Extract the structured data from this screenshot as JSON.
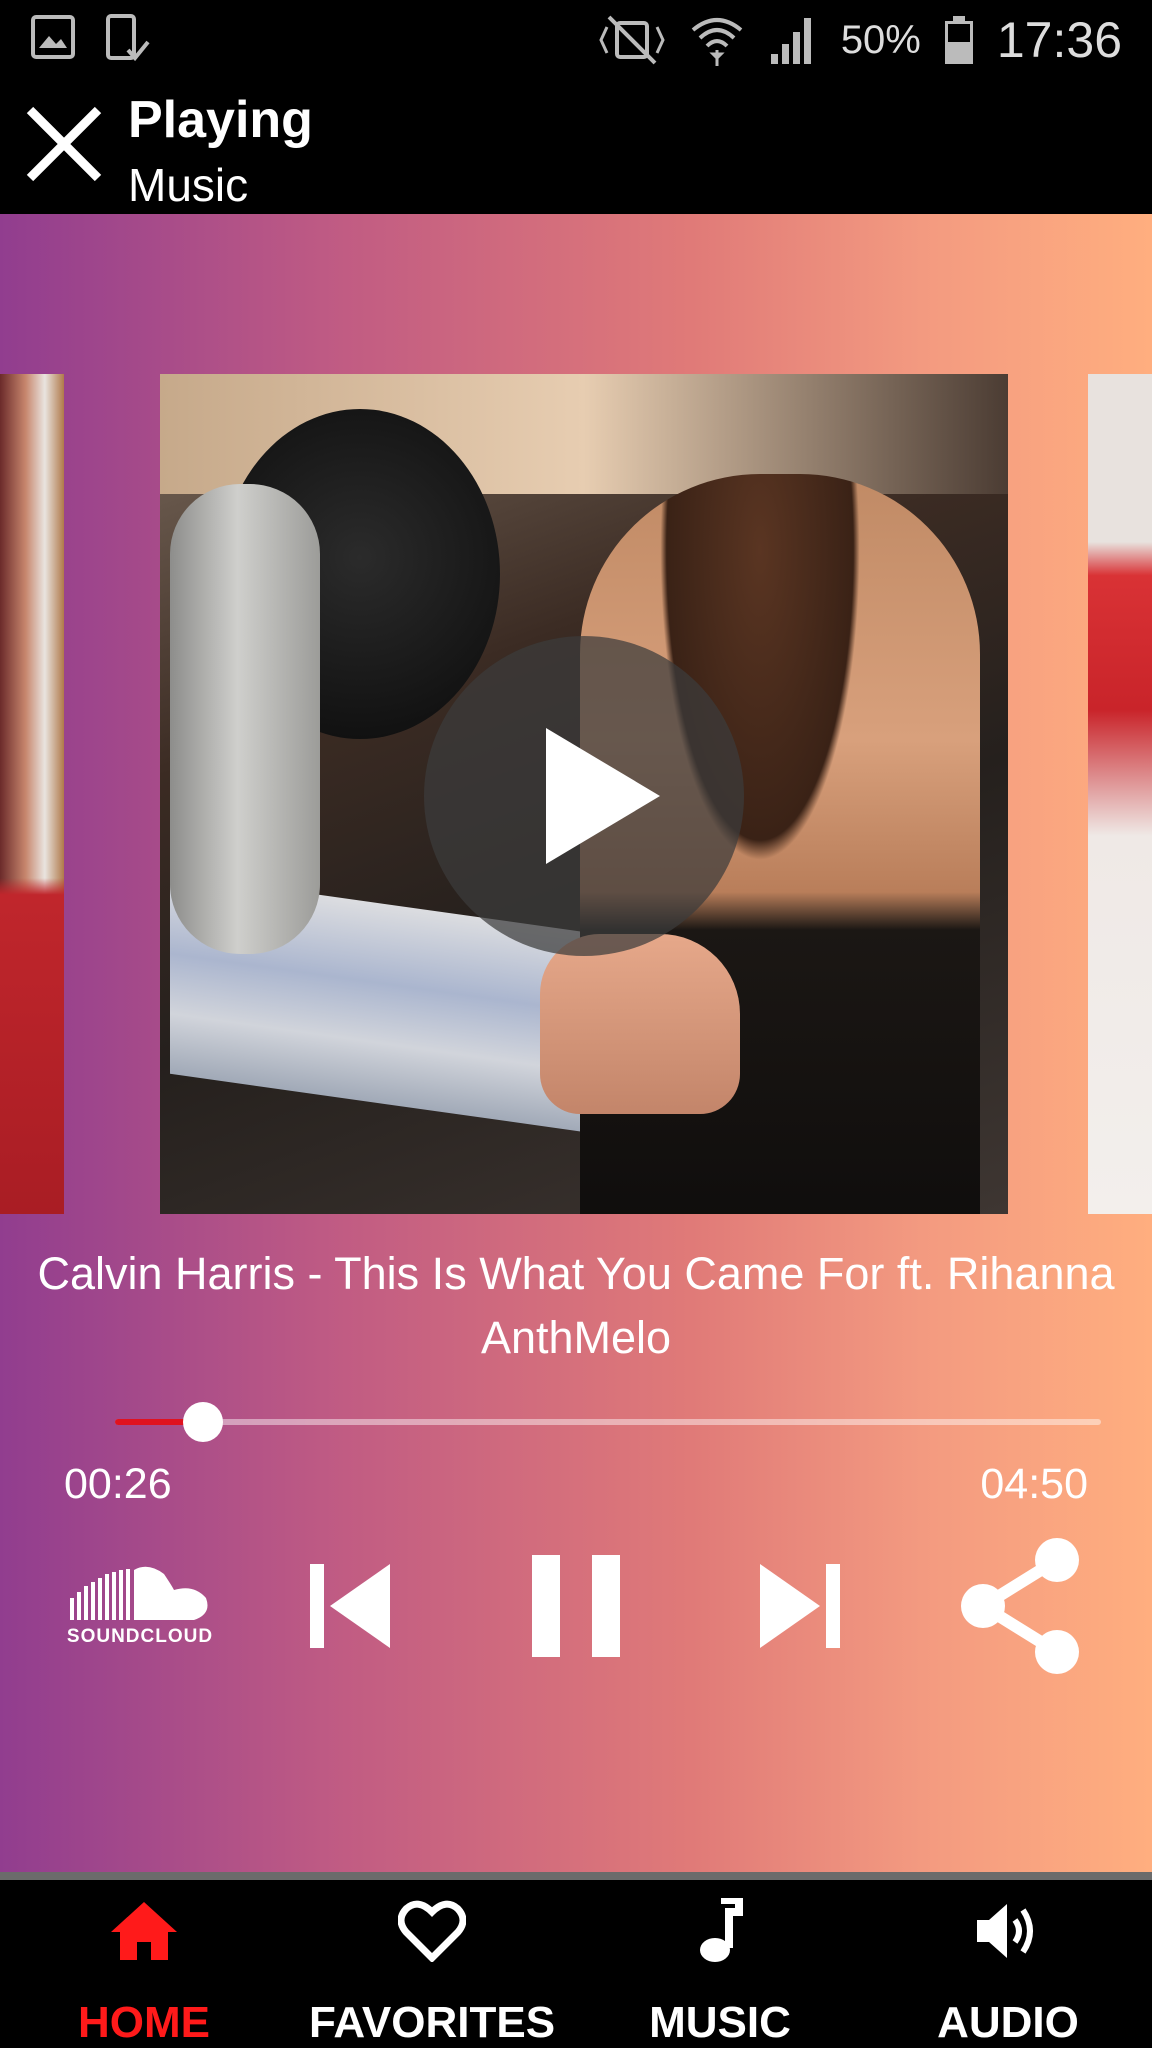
{
  "status_bar": {
    "battery_percent": "50%",
    "time": "17:36",
    "icons": [
      "gallery-icon",
      "device-check-icon",
      "vibrate-mute-icon",
      "wifi-icon",
      "signal-icon",
      "battery-icon"
    ]
  },
  "header": {
    "title": "Playing",
    "subtitle": "Music",
    "close_icon": "close-icon"
  },
  "player": {
    "track_title": "Calvin Harris - This Is What You Came For ft. Rihanna",
    "artist": "AnthMelo",
    "elapsed": "00:26",
    "total": "04:50",
    "progress_fraction": 0.089,
    "state": "playing",
    "source_logo_text": "SOUNDCLOUD",
    "accent_color": "#e0121f",
    "gradient_colors": [
      "#913d8f",
      "#ffae7f"
    ]
  },
  "nav": {
    "items": [
      {
        "label": "HOME",
        "icon": "home-icon",
        "active": true
      },
      {
        "label": "FAVORITES",
        "icon": "heart-icon",
        "active": false
      },
      {
        "label": "MUSIC",
        "icon": "music-note-icon",
        "active": false
      },
      {
        "label": "AUDIO",
        "icon": "speaker-icon",
        "active": false
      }
    ],
    "active_color": "#ff1a1a"
  }
}
